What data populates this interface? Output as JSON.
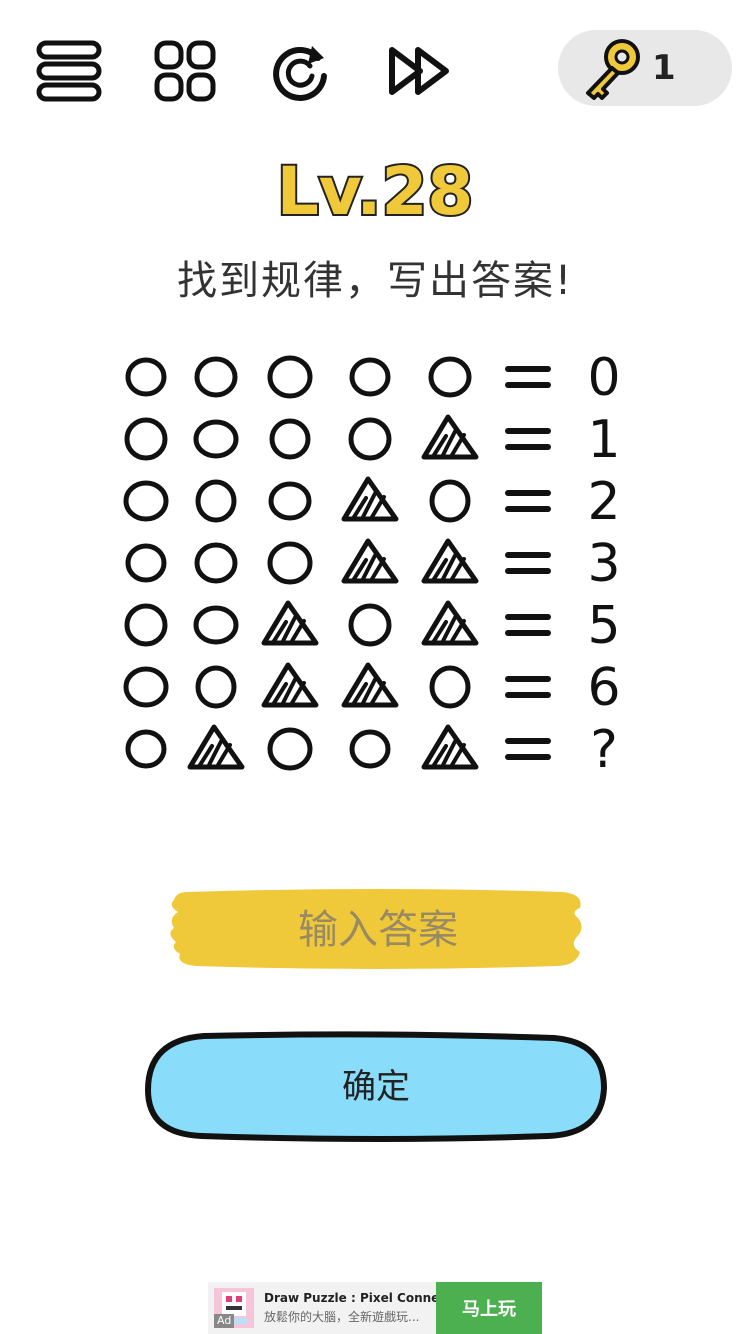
{
  "toolbar": {
    "menu_icon": "menu-icon",
    "levels_icon": "grid-icon",
    "restart_icon": "restart-icon",
    "skip_icon": "fast-forward-icon",
    "keys_icon": "key-icon",
    "keys_count": "1"
  },
  "header": {
    "level": "Lv.28",
    "level_color": "#f0c93a",
    "prompt": "找到规律，写出答案!"
  },
  "puzzle": {
    "rows": [
      {
        "symbols": [
          "circle",
          "circle",
          "circle",
          "circle",
          "circle"
        ],
        "equals": "=",
        "result": "0"
      },
      {
        "symbols": [
          "circle",
          "circle",
          "circle",
          "circle",
          "triangle"
        ],
        "equals": "=",
        "result": "1"
      },
      {
        "symbols": [
          "circle",
          "circle",
          "circle",
          "triangle",
          "circle"
        ],
        "equals": "=",
        "result": "2"
      },
      {
        "symbols": [
          "circle",
          "circle",
          "circle",
          "triangle",
          "triangle"
        ],
        "equals": "=",
        "result": "3"
      },
      {
        "symbols": [
          "circle",
          "circle",
          "triangle",
          "circle",
          "triangle"
        ],
        "equals": "=",
        "result": "5"
      },
      {
        "symbols": [
          "circle",
          "circle",
          "triangle",
          "triangle",
          "circle"
        ],
        "equals": "=",
        "result": "6"
      },
      {
        "symbols": [
          "circle",
          "triangle",
          "circle",
          "circle",
          "triangle"
        ],
        "equals": "=",
        "result": "?"
      }
    ]
  },
  "answer": {
    "placeholder": "输入答案",
    "value": "",
    "bg_color": "#f0c93a"
  },
  "confirm": {
    "label": "确定",
    "bg_color": "#8adcfb"
  },
  "ad": {
    "badge": "Ad",
    "title": "Draw Puzzle : Pixel Connec...",
    "description": "放鬆你的大腦，全新遊戲玩...",
    "cta": "马上玩",
    "cta_color": "#4caf50"
  }
}
